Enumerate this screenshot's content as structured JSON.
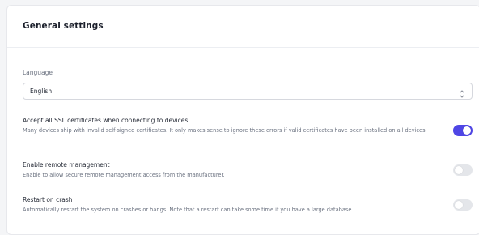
{
  "card": {
    "title": "General settings"
  },
  "language": {
    "label": "Language",
    "selected": "English",
    "icon": "chevron-up-down-icon"
  },
  "settings": [
    {
      "title": "Accept all SSL certificates when connecting to devices",
      "description": "Many devices ship with invalid self-signed certificates. It only makes sense to ignore these errors if valid certificates have been installed on all devices.",
      "enabled": true
    },
    {
      "title": "Enable remote management",
      "description": "Enable to allow secure remote management access from the manufacturer.",
      "enabled": false
    },
    {
      "title": "Restart on crash",
      "description": "Automatically restart the system on crashes or hangs. Note that a restart can take some time if you have a large database.",
      "enabled": false
    }
  ],
  "colors": {
    "accent": "#4f46e5",
    "toggle_off": "#e4e6ea"
  }
}
